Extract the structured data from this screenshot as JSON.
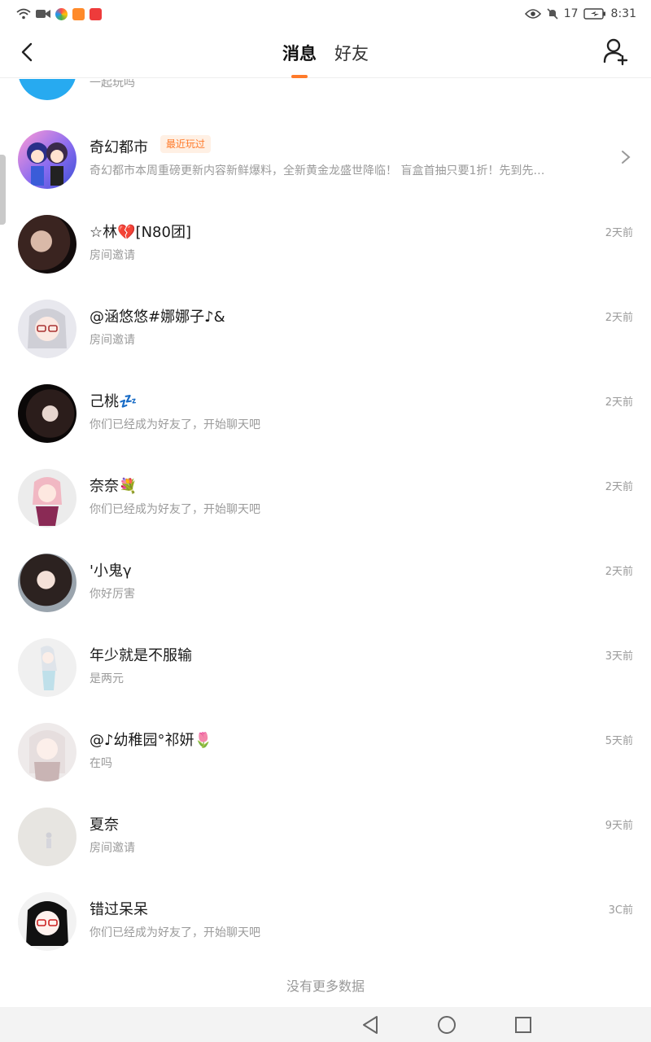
{
  "status_bar": {
    "time": "8:31",
    "signal": "17"
  },
  "header": {
    "tabs": [
      {
        "label": "消息",
        "active": true
      },
      {
        "label": "好友",
        "active": false
      }
    ]
  },
  "messages": [
    {
      "name": "",
      "preview": "一起玩吗",
      "time": ""
    },
    {
      "name": "奇幻都市",
      "badge": "最近玩过",
      "preview": "奇幻都市本周重磅更新内容新鲜爆料，全新黄金龙盛世降临！ 盲盒首抽只要1折！先到先…",
      "time": ""
    },
    {
      "name": "☆林💔[N80团]",
      "preview": "房间邀请",
      "time": "2天前"
    },
    {
      "name": "@涵悠悠#娜娜子♪&",
      "preview": "房间邀请",
      "time": "2天前"
    },
    {
      "name": "己桃💤",
      "preview": "你们已经成为好友了，开始聊天吧",
      "time": "2天前"
    },
    {
      "name": "奈奈💐",
      "preview": "你们已经成为好友了，开始聊天吧",
      "time": "2天前"
    },
    {
      "name": "'小鬼γ",
      "preview": "你好厉害",
      "time": "2天前"
    },
    {
      "name": "年少就是不服输",
      "preview": "是两元",
      "time": "3天前"
    },
    {
      "name": "@♪幼稚园°祁妍🌷",
      "preview": "在吗",
      "time": "5天前"
    },
    {
      "name": "夏奈",
      "preview": "房间邀请",
      "time": "9天前"
    },
    {
      "name": "错过呆呆",
      "preview": "你们已经成为好友了，开始聊天吧",
      "time": "3C前"
    }
  ],
  "footer": {
    "no_more": "没有更多数据"
  },
  "colors": {
    "accent": "#ff7a2a",
    "muted": "#9a9a9a"
  }
}
